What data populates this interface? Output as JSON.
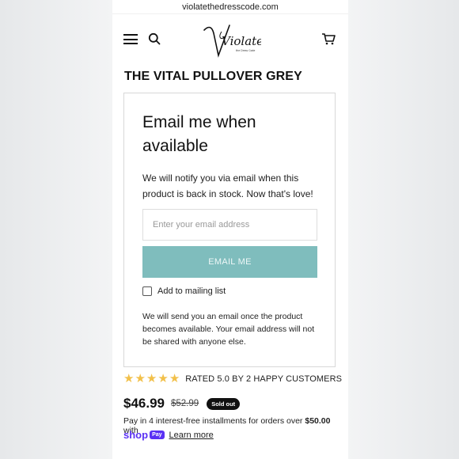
{
  "browser": {
    "url": "violatethedresscode.com"
  },
  "header": {
    "logo_text": "Violate",
    "logo_subtext": "the Dress Code"
  },
  "product": {
    "title": "THE VITAL PULLOVER GREY",
    "price": "$46.99",
    "compare_price": "$52.99",
    "badge": "Sold out"
  },
  "notify_form": {
    "heading": "Email me when available",
    "message": "We will notify you via email when this product is back in stock. Now that's love!",
    "email_placeholder": "Enter your email address",
    "email_value": "",
    "submit_label": "EMAIL ME",
    "mailing_list_label": "Add to mailing list",
    "mailing_list_checked": false,
    "disclaimer": "We will send you an email once the product becomes available. Your email address will not be shared with anyone else."
  },
  "rating": {
    "stars": 5,
    "text": "RATED 5.0 BY 2 HAPPY CUSTOMERS"
  },
  "installments": {
    "text_prefix": "Pay in 4 interest-free installments for orders over",
    "amount": "$50.00",
    "text_suffix": "with",
    "shop_text": "shop",
    "pay_text": "Pay",
    "learn_more": "Learn more"
  },
  "colors": {
    "accent": "#7fbdbd",
    "star": "#f2c04a",
    "shop_pay": "#5a31f4"
  },
  "icons": [
    "hamburger-menu-icon",
    "search-icon",
    "cart-icon",
    "star-icon",
    "checkbox-icon"
  ]
}
